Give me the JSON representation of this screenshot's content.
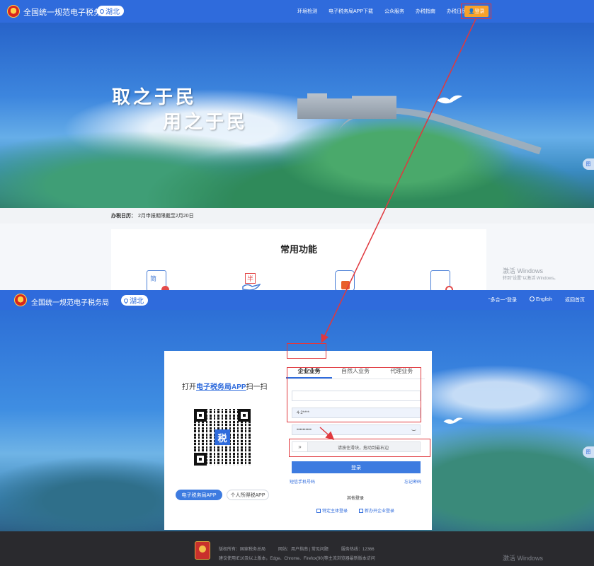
{
  "top": {
    "site_title": "全国统一规范电子税务局",
    "region": "湖北",
    "nav_links": [
      "环境检测",
      "电子税务局APP下载",
      "公众服务",
      "办税指南",
      "办税日历"
    ],
    "login_label": "登录",
    "slogan_line1": "取之于民",
    "slogan_line2": "用之于民",
    "calendar_label": "办税日历：",
    "calendar_text": "2月申报期限截至2月20日",
    "common_title": "常用功能",
    "func_icons": [
      "简",
      "半"
    ],
    "watermark_title": "激活 Windows",
    "watermark_sub": "转到\"设置\"以激活 Windows。"
  },
  "bottom": {
    "site_title": "全国统一规范电子税务局",
    "region": "湖北",
    "nav_links": [
      "\"多合一\"登录",
      "English",
      "返回首页"
    ],
    "qr": {
      "prefix": "打开",
      "highlight": "电子税务局APP",
      "suffix": "扫一扫",
      "logo_char": "税"
    },
    "app_buttons": [
      "电子税务局APP",
      "个人所得税APP"
    ],
    "tabs": [
      "企业业务",
      "自然人业务",
      "代理业务"
    ],
    "fields": {
      "credit_code": "",
      "id_number": "4-2****",
      "password": "••••••••••"
    },
    "slider_hint": "请按住滑块，拖动到最右边",
    "submit_label": "登录",
    "link_left": "短信手机号码",
    "link_right": "忘记密码",
    "other_login": "其他登录",
    "other_options": [
      "特定主体登录",
      "新办开企业登录"
    ],
    "footer": {
      "line1": [
        "版权所有：国家税务总局",
        "网站：用户指南 | 常见问题",
        "服务热线：12366"
      ],
      "line2": "建议使用IE10及以上版本，Edge、Chrome、Firefox(90)等主流浏览器最新版本访问"
    },
    "watermark_title": "激活 Windows"
  },
  "colors": {
    "brand_blue": "#2f6bdc",
    "login_orange": "#f7a12a",
    "annotation_red": "#e0383e"
  }
}
